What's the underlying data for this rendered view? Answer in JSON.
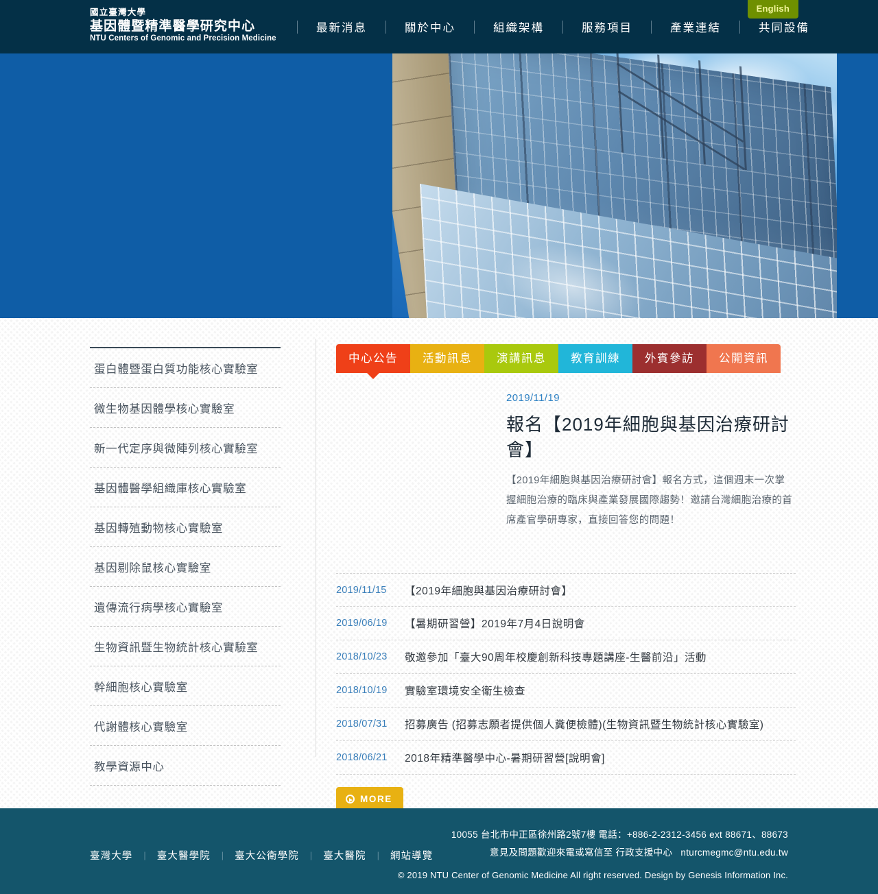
{
  "header": {
    "logo": {
      "university": "國立臺灣大學",
      "center": "基因體暨精準醫學研究中心",
      "english": "NTU Centers of Genomic and Precision Medicine"
    },
    "lang_button": "English",
    "nav": [
      {
        "label": "最新消息"
      },
      {
        "label": "關於中心"
      },
      {
        "label": "組織架構"
      },
      {
        "label": "服務項目"
      },
      {
        "label": "產業連結"
      },
      {
        "label": "共同設備"
      }
    ]
  },
  "hero": {
    "image_alt": "ntu-genomic-medicine-building-photo",
    "background_color": "#0f5da6"
  },
  "sidebar": {
    "items": [
      {
        "label": "蛋白體暨蛋白質功能核心實驗室"
      },
      {
        "label": "微生物基因體學核心實驗室"
      },
      {
        "label": "新一代定序與微陣列核心實驗室"
      },
      {
        "label": "基因體醫學組織庫核心實驗室"
      },
      {
        "label": "基因轉殖動物核心實驗室"
      },
      {
        "label": "基因剔除鼠核心實驗室"
      },
      {
        "label": "遺傳流行病學核心實驗室"
      },
      {
        "label": "生物資訊暨生物統計核心實驗室"
      },
      {
        "label": "幹細胞核心實驗室"
      },
      {
        "label": "代謝體核心實驗室"
      },
      {
        "label": "教學資源中心"
      }
    ]
  },
  "main": {
    "tabs": [
      {
        "label": "中心公告",
        "color": "#ef4018",
        "active": true
      },
      {
        "label": "活動訊息",
        "color": "#e8b112",
        "active": false
      },
      {
        "label": "演講訊息",
        "color": "#a9c90d",
        "active": false
      },
      {
        "label": "教育訓練",
        "color": "#21b6d9",
        "active": false
      },
      {
        "label": "外賓參訪",
        "color": "#9c2f2f",
        "active": false
      },
      {
        "label": "公開資訊",
        "color": "#f0764f",
        "active": false
      }
    ],
    "feature": {
      "date": "2019/11/19",
      "title": "報名【2019年細胞與基因治療研討會】",
      "description": "【2019年細胞與基因治療研討會】報名方式，這個週末一次掌握細胞治療的臨床與產業發展國際趨勢！邀請台灣細胞治療的首席產官學研專家，直接回答您的問題！"
    },
    "news": [
      {
        "date": "2019/11/15",
        "title": "【2019年細胞與基因治療研討會】"
      },
      {
        "date": "2019/06/19",
        "title": "【暑期研習營】2019年7月4日說明會"
      },
      {
        "date": "2018/10/23",
        "title": "敬邀參加「臺大90周年校慶創新科技專題講座-生醫前沿」活動"
      },
      {
        "date": "2018/10/19",
        "title": "實驗室環境安全衛生檢查"
      },
      {
        "date": "2018/07/31",
        "title": "招募廣告 (招募志願者提供個人糞便檢體)(生物資訊暨生物統計核心實驗室)"
      },
      {
        "date": "2018/06/21",
        "title": "2018年精準醫學中心-暑期研習營[說明會]"
      }
    ],
    "more_button": "MORE"
  },
  "footer": {
    "links": [
      {
        "label": "臺灣大學"
      },
      {
        "label": "臺大醫學院"
      },
      {
        "label": "臺大公衛學院"
      },
      {
        "label": "臺大醫院"
      },
      {
        "label": "網站導覽"
      }
    ],
    "link_separator": "|",
    "address_line": "10055 台北市中正區徐州路2號7樓 電話：+886-2-2312-3456 ext 88671、88673",
    "contact_prefix": "意見及問題歡迎來電或寫信至 行政支援中心",
    "email": "nturcmegmc@ntu.edu.tw",
    "copyright": "© 2019 NTU Center of Genomic Medicine All right reserved. Design by Genesis Information Inc."
  }
}
